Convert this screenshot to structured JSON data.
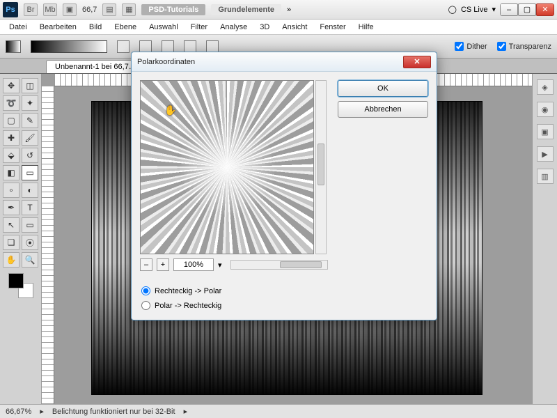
{
  "appbar": {
    "logo": "Ps",
    "zoom": "66,7",
    "tab1": "PSD-Tutorials",
    "tab2": "Grundelemente",
    "cslive": "CS Live"
  },
  "menu": [
    "Datei",
    "Bearbeiten",
    "Bild",
    "Ebene",
    "Auswahl",
    "Filter",
    "Analyse",
    "3D",
    "Ansicht",
    "Fenster",
    "Hilfe"
  ],
  "optbar": {
    "dither": "Dither",
    "transparenz": "Transparenz"
  },
  "doctab": "Unbenannt-1 bei 66,7…",
  "status": {
    "zoom": "66,67%",
    "msg": "Belichtung funktioniert nur bei 32-Bit"
  },
  "dialog": {
    "title": "Polarkoordinaten",
    "ok": "OK",
    "cancel": "Abbrechen",
    "zoom": "100%",
    "opt1": "Rechteckig -> Polar",
    "opt2": "Polar -> Rechteckig"
  }
}
